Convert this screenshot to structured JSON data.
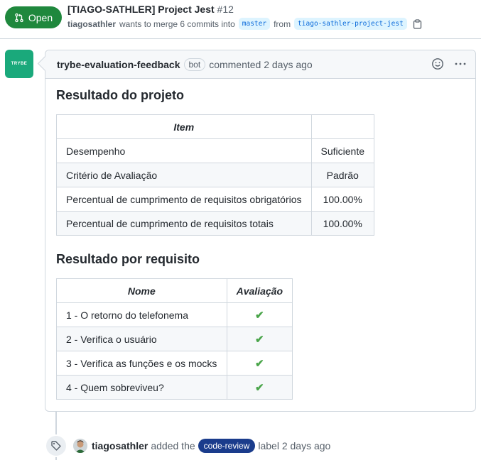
{
  "pr": {
    "state": "Open",
    "title": "[TIAGO-SATHLER] Project Jest",
    "number": "#12",
    "author": "tiagosathler",
    "merge_text": "wants to merge 6 commits into",
    "base_branch": "master",
    "from_text": "from",
    "head_branch": "tiago-sathler-project-jest"
  },
  "comment": {
    "avatar_text": "TRYBE",
    "author": "trybe-evaluation-feedback",
    "badge": "bot",
    "action": "commented 2 days ago",
    "section1_title": "Resultado do projeto",
    "table1": {
      "headers": [
        "Item",
        ""
      ],
      "rows": [
        [
          "Desempenho",
          "Suficiente"
        ],
        [
          "Critério de Avaliação",
          "Padrão"
        ],
        [
          "Percentual de cumprimento de requisitos obrigatórios",
          "100.00%"
        ],
        [
          "Percentual de cumprimento de requisitos totais",
          "100.00%"
        ]
      ]
    },
    "section2_title": "Resultado por requisito",
    "table2": {
      "headers": [
        "Nome",
        "Avaliação"
      ],
      "rows": [
        [
          "1 - O retorno do telefonema",
          "✔"
        ],
        [
          "2 - Verifica o usuário",
          "✔"
        ],
        [
          "3 - Verifica as funções e os mocks",
          "✔"
        ],
        [
          "4 - Quem sobreviveu?",
          "✔"
        ]
      ]
    }
  },
  "event": {
    "icon": "tag-icon",
    "user": "tiagosathler",
    "text_before": "added the",
    "label": "code-review",
    "label_color": "#1a3c8c",
    "text_after": "label 2 days ago"
  },
  "colors": {
    "open_green": "#1f883d",
    "bot_avatar": "#1aa97b",
    "check_green": "#4aa54a"
  }
}
